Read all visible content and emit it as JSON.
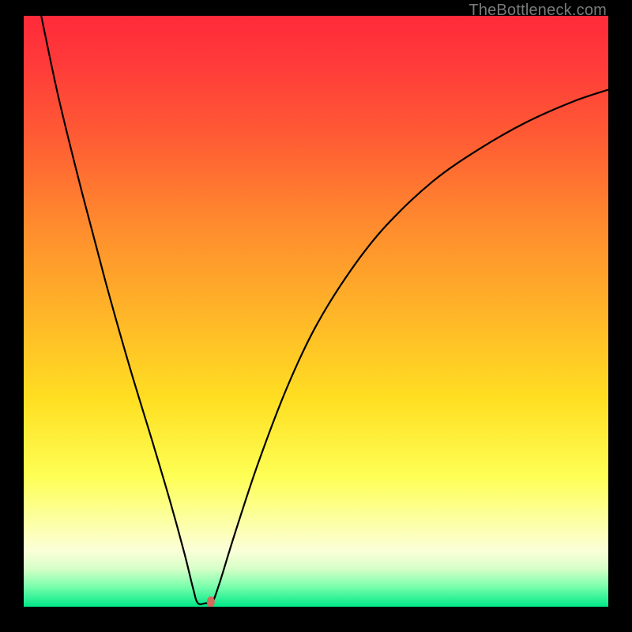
{
  "watermark": "TheBottleneck.com",
  "chart_data": {
    "type": "line",
    "title": "",
    "xlabel": "",
    "ylabel": "",
    "xlim": [
      0,
      100
    ],
    "ylim": [
      0,
      100
    ],
    "background_gradient": {
      "stops": [
        {
          "offset": 0.0,
          "color": "#ff2a3a"
        },
        {
          "offset": 0.08,
          "color": "#ff3a3a"
        },
        {
          "offset": 0.2,
          "color": "#ff5a34"
        },
        {
          "offset": 0.35,
          "color": "#ff8a2e"
        },
        {
          "offset": 0.5,
          "color": "#ffb428"
        },
        {
          "offset": 0.65,
          "color": "#ffdf22"
        },
        {
          "offset": 0.78,
          "color": "#feff55"
        },
        {
          "offset": 0.86,
          "color": "#fcffa8"
        },
        {
          "offset": 0.905,
          "color": "#fbffd8"
        },
        {
          "offset": 0.935,
          "color": "#d8ffc8"
        },
        {
          "offset": 0.965,
          "color": "#7dffad"
        },
        {
          "offset": 1.0,
          "color": "#00e888"
        }
      ]
    },
    "series": [
      {
        "name": "bottleneck-curve",
        "color": "#000000",
        "width": 2.2,
        "points": [
          {
            "x": 3.0,
            "y": 100.0
          },
          {
            "x": 6.0,
            "y": 86.0
          },
          {
            "x": 10.0,
            "y": 70.0
          },
          {
            "x": 14.0,
            "y": 55.0
          },
          {
            "x": 18.0,
            "y": 41.0
          },
          {
            "x": 22.0,
            "y": 28.0
          },
          {
            "x": 25.0,
            "y": 18.0
          },
          {
            "x": 27.5,
            "y": 9.0
          },
          {
            "x": 29.0,
            "y": 3.0
          },
          {
            "x": 29.8,
            "y": 0.6
          },
          {
            "x": 31.2,
            "y": 0.6
          },
          {
            "x": 32.2,
            "y": 0.6
          },
          {
            "x": 33.5,
            "y": 4.0
          },
          {
            "x": 36.0,
            "y": 12.0
          },
          {
            "x": 40.0,
            "y": 24.0
          },
          {
            "x": 45.0,
            "y": 37.0
          },
          {
            "x": 50.0,
            "y": 47.5
          },
          {
            "x": 56.0,
            "y": 57.0
          },
          {
            "x": 62.0,
            "y": 64.5
          },
          {
            "x": 70.0,
            "y": 72.0
          },
          {
            "x": 78.0,
            "y": 77.5
          },
          {
            "x": 86.0,
            "y": 82.0
          },
          {
            "x": 94.0,
            "y": 85.5
          },
          {
            "x": 100.0,
            "y": 87.5
          }
        ]
      }
    ],
    "marker": {
      "x": 32.0,
      "y": 0.8,
      "rx": 5,
      "ry": 7,
      "fill": "#d46a5a"
    }
  }
}
